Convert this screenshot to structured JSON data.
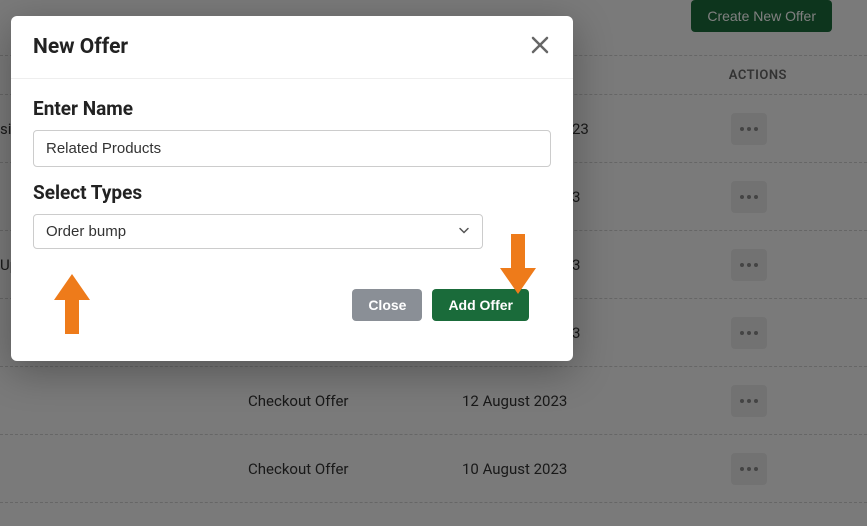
{
  "header": {
    "create_button": "Create New Offer",
    "actions_col": "ACTIONS"
  },
  "rows": [
    {
      "name_frag": "si",
      "type": "",
      "date": "23"
    },
    {
      "name_frag": "",
      "type": "",
      "date": "3"
    },
    {
      "name_frag": "Up",
      "type": "",
      "date": "3"
    },
    {
      "name_frag": "",
      "type": "",
      "date": "3"
    },
    {
      "name_frag": "",
      "type": "Checkout Offer",
      "date": "12 August 2023"
    },
    {
      "name_frag": "",
      "type": "Checkout Offer",
      "date": "10 August 2023"
    }
  ],
  "modal": {
    "title": "New Offer",
    "name_label": "Enter Name",
    "name_value": "Related Products",
    "types_label": "Select Types",
    "types_value": "Order bump",
    "close_label": "Close",
    "add_label": "Add Offer"
  }
}
